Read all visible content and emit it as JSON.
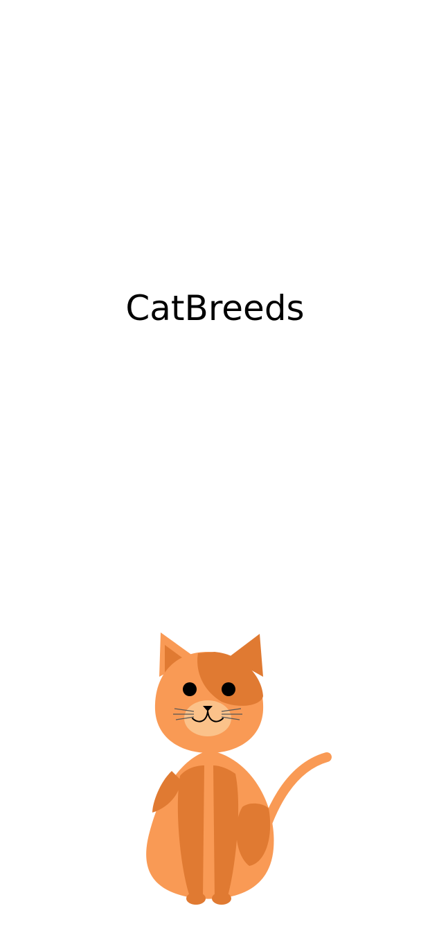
{
  "app": {
    "title": "CatBreeds"
  },
  "illustration": {
    "icon": "cat-icon",
    "colors": {
      "body_light": "#F99A55",
      "body_dark": "#E07A32",
      "muzzle": "#FBC28A",
      "eyes": "#000000"
    }
  },
  "colors": {
    "background": "#FFFFFF",
    "text": "#000000"
  }
}
